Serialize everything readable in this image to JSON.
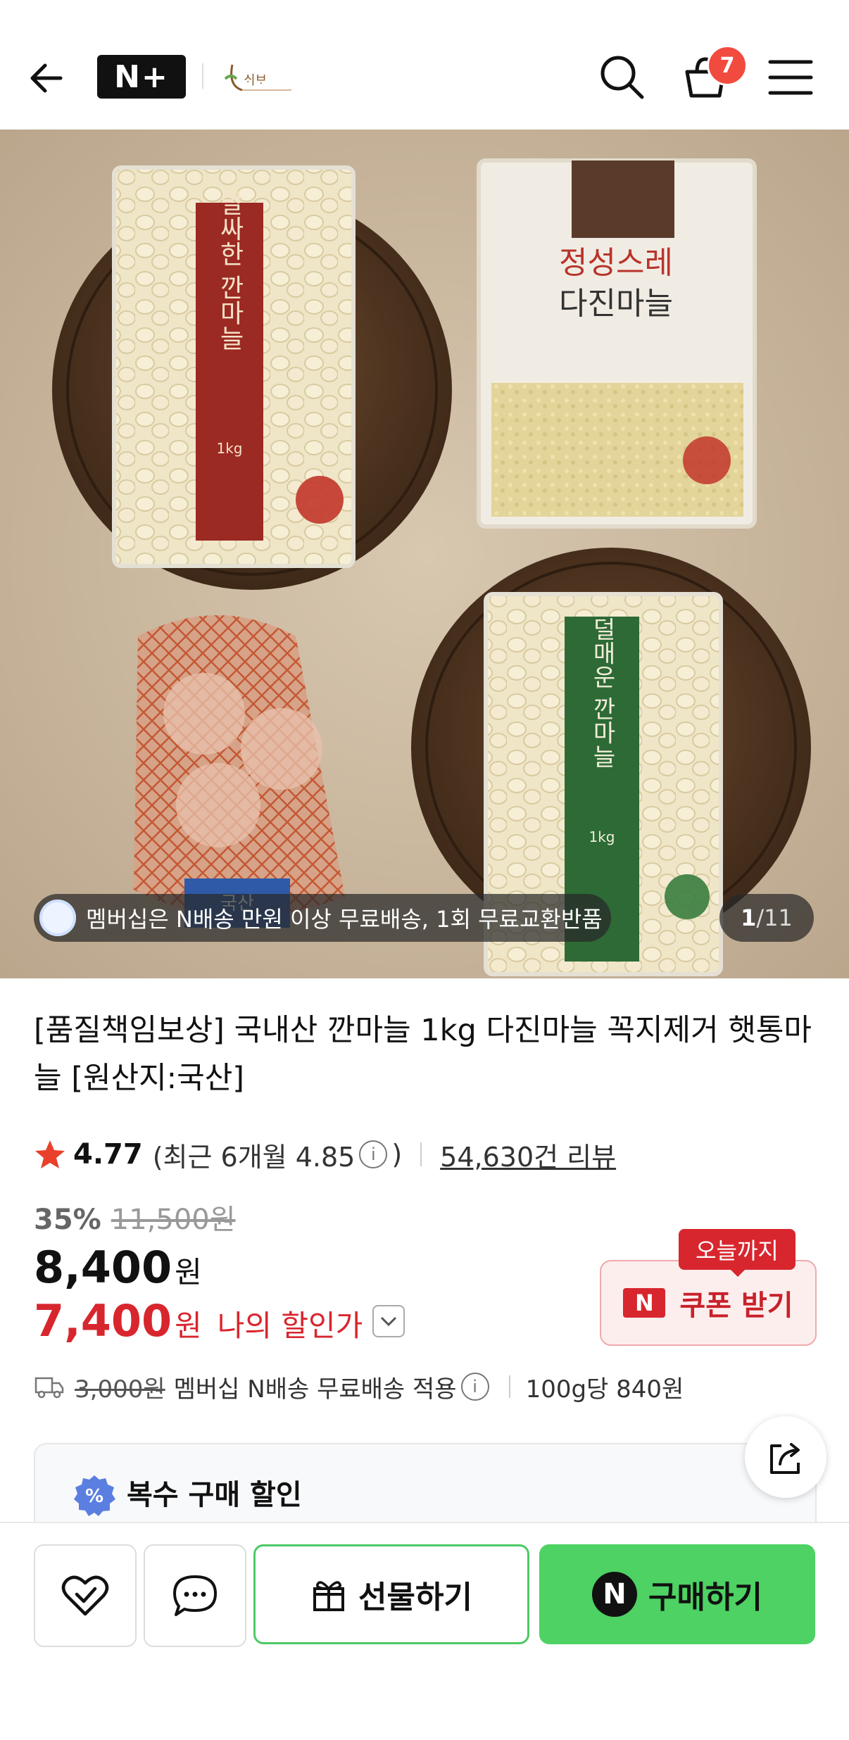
{
  "header": {
    "logo_text": "N+",
    "brand_name": "브랜드 로고",
    "cart_count": "7"
  },
  "hero": {
    "promo_text": "멤버십은 N배송 만원 이상 무료배송, 1회 무료교환반품",
    "current_index": "1",
    "total_count": "/11",
    "pack_red_title": "알싸한 깐마늘",
    "pack_red_weight": "1kg",
    "pack_mince_title1": "정성스레",
    "pack_mince_title2": "다진마늘",
    "pack_green_title": "덜매운 깐마늘",
    "pack_green_weight": "1kg",
    "net_label": "국산"
  },
  "product": {
    "title": "[품질책임보상] 국내산 깐마늘 1kg 다진마늘 꼭지제거 햇통마늘 [원산지:국산]",
    "rating": "4.77",
    "recent_rating_open": "(최근 6개월 4.85",
    "recent_rating_close": ")",
    "reviews": "54,630건 리뷰",
    "discount_pct": "35%",
    "original_price": "11,500원",
    "price": "8,400",
    "price_unit": "원",
    "my_price": "7,400",
    "my_price_unit": "원",
    "my_price_label": "나의 할인가",
    "coupon_badge": "오늘까지",
    "coupon_logo": "N",
    "coupon_label": "쿠폰 받기",
    "ship_fee": "3,000원",
    "ship_text": "멤버십 N배송 무료배송 적용",
    "unit_price": "100g당 840원",
    "multi_discount": "복수 구매 할인"
  },
  "bottom": {
    "gift_label": "선물하기",
    "buy_logo": "N",
    "buy_label": "구매하기"
  },
  "colors": {
    "accent_red": "#d8262e",
    "buy_green": "#4dd263",
    "badge_orange": "#f04b3e"
  }
}
